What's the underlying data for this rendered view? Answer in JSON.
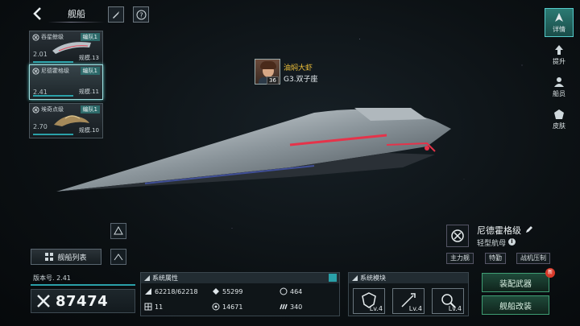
{
  "header": {
    "title": "舰船"
  },
  "ship_list": [
    {
      "name": "吞星鲸级",
      "fleet": "编队1",
      "power": "2.01",
      "scale": "规模.13",
      "selected": false
    },
    {
      "name": "尼德霍格级",
      "fleet": "编队1",
      "power": "2.41",
      "scale": "规模.11",
      "selected": true
    },
    {
      "name": "埃奇点级",
      "fleet": "编队1",
      "power": "2.70",
      "scale": "规模.10",
      "selected": false
    }
  ],
  "captain": {
    "name": "油焖大虾",
    "level": "36",
    "location": "G3.双子座"
  },
  "right_nav": [
    {
      "label": "详情",
      "icon": "ship-detail-icon",
      "active": true
    },
    {
      "label": "提升",
      "icon": "upgrade-arrow-icon",
      "active": false
    },
    {
      "label": "船员",
      "icon": "crew-icon",
      "active": false
    },
    {
      "label": "皮肤",
      "icon": "skin-icon",
      "active": false
    }
  ],
  "ship_info": {
    "name": "尼德霍格级",
    "type": "轻型航母",
    "tags": [
      "主力舰",
      "特勤",
      "战机压制"
    ]
  },
  "left_controls": {
    "fleet_list_label": "舰船列表"
  },
  "version": {
    "label": "版本号. 2.41"
  },
  "power": {
    "value": "87474"
  },
  "attributes": {
    "title": "系统属性",
    "items": [
      {
        "icon": "hull-icon",
        "value": "62218/62218"
      },
      {
        "icon": "armor-icon",
        "value": "55299"
      },
      {
        "icon": "shield-icon",
        "value": "464"
      },
      {
        "icon": "grid-icon",
        "value": "11"
      },
      {
        "icon": "target-icon",
        "value": "14671"
      },
      {
        "icon": "speed-icon",
        "value": "340"
      }
    ]
  },
  "modules": {
    "title": "系统模块",
    "slots": [
      {
        "icon": "armor-module-icon",
        "level": "Lv.4"
      },
      {
        "icon": "missile-module-icon",
        "level": "Lv.4"
      },
      {
        "icon": "radar-module-icon",
        "level": "Lv.4"
      }
    ]
  },
  "actions": {
    "equip_weapon": "装配武器",
    "modify_ship": "舰船改装",
    "new_badge": "新"
  },
  "colors": {
    "accent": "#2aa0a8",
    "captain_name": "#f0c23a",
    "action_border": "#3f9e74",
    "badge": "#d93a2a"
  }
}
